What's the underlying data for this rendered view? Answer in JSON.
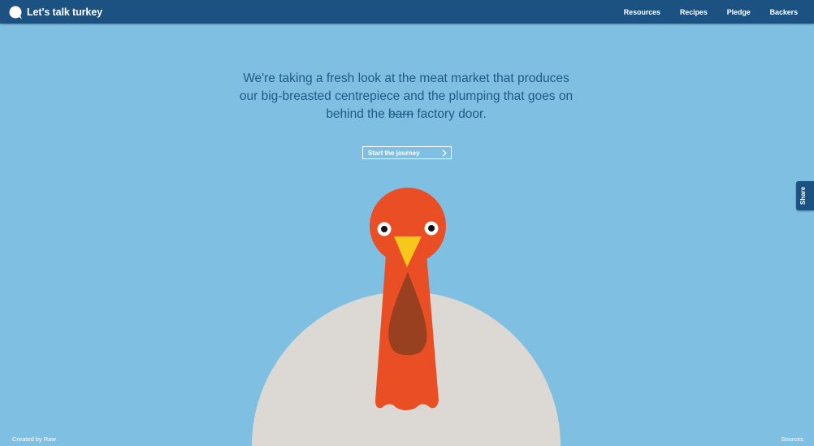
{
  "header": {
    "brand": "Let's talk turkey",
    "brand_icon": "speech-bubble-icon",
    "nav": [
      "Resources",
      "Recipes",
      "Pledge",
      "Backers"
    ]
  },
  "intro": {
    "line1": "We're taking a fresh look at the meat market that produces",
    "line2": "our big-breasted centrepiece and the plumping that goes on",
    "line3_before": "behind the ",
    "line3_struck": "barn",
    "line3_after": " factory door."
  },
  "cta": {
    "label": "Start the journey",
    "icon": "chevron-right-icon"
  },
  "share": {
    "label": "Share"
  },
  "footer": {
    "credit": "Created by Raw",
    "sources": "Sources"
  },
  "colors": {
    "sky": "#7fc0e2",
    "header": "#1b5282",
    "intro_text": "#215a86",
    "turkey_head": "#e94e25",
    "wattle": "#98401f",
    "beak": "#f7c81c",
    "body": "#dcd9d4"
  }
}
